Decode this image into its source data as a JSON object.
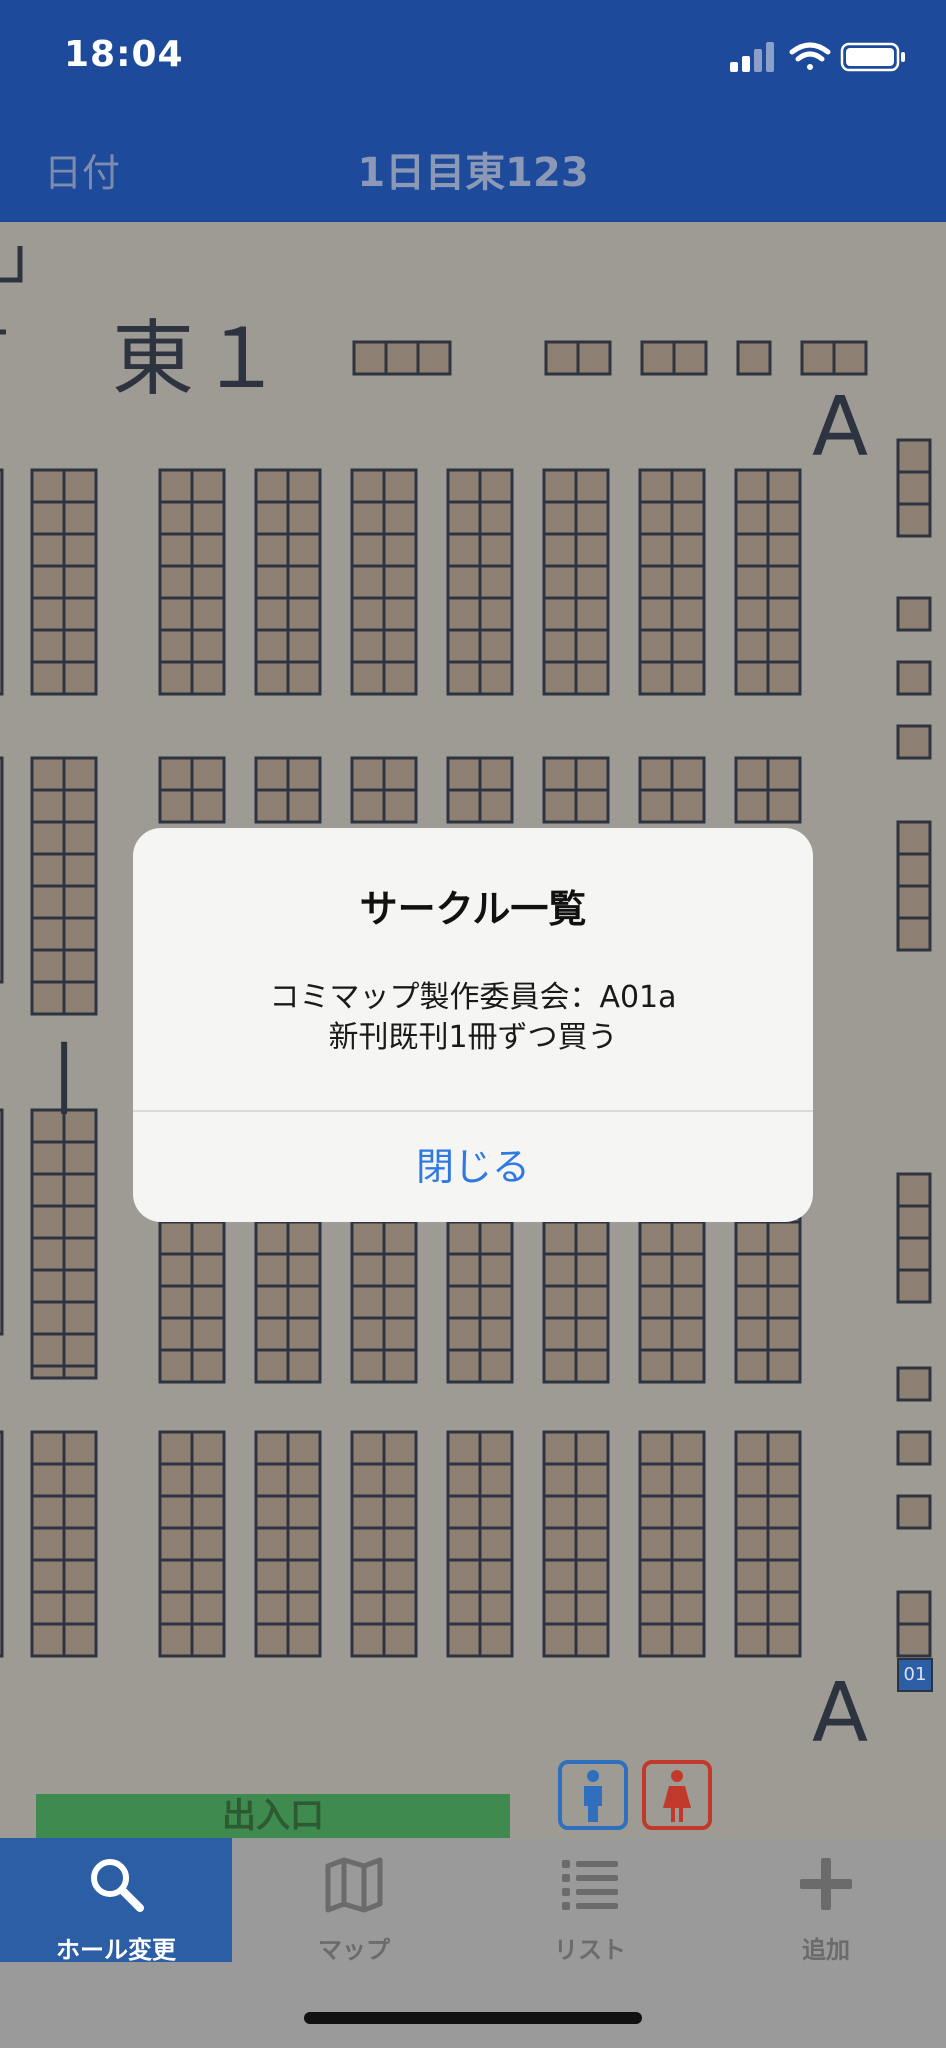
{
  "status_bar": {
    "time": "18:04"
  },
  "nav": {
    "left_label": "日付",
    "title": "1日目東123"
  },
  "map": {
    "hall_label": "東１",
    "row_letters": [
      "A",
      "A"
    ],
    "separator": "|",
    "booth_number": "01",
    "exit_label": "出入口",
    "restroom_icons": [
      "male-restroom-icon",
      "female-restroom-icon"
    ]
  },
  "alert": {
    "title": "サークル一覧",
    "message_line1": "コミマップ製作委員会：A01a",
    "message_line2": "新刊既刊1冊ずつ買う",
    "button": "閉じる"
  },
  "tabbar": {
    "items": [
      {
        "label": "ホール変更",
        "icon": "search-icon",
        "active": true
      },
      {
        "label": "マップ",
        "icon": "map-icon",
        "active": false
      },
      {
        "label": "リスト",
        "icon": "list-icon",
        "active": false
      },
      {
        "label": "追加",
        "icon": "plus-icon",
        "active": false
      }
    ]
  },
  "colors": {
    "header": "#1d4a9a",
    "tab_active": "#2c5ea6",
    "alert_button": "#2f7ae0",
    "booth_fill": "#8e8174",
    "exit_fill": "#3e8a4f"
  }
}
